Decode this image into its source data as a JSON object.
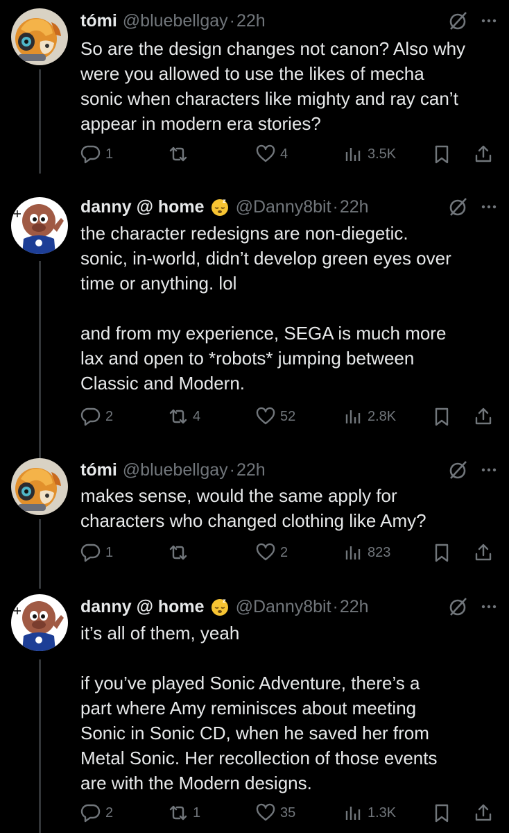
{
  "tweets": [
    {
      "name": "tómi",
      "handle": "@bluebellgay",
      "dot": "·",
      "time": "22h",
      "text": "So are the design changes not canon? Also why\nwere you allowed to use the likes of mecha\nsonic when characters like mighty and ray can’t\nappear in modern era stories?",
      "replies": "1",
      "reposts": "",
      "likes": "4",
      "views": "3.5K",
      "avatar": "tomi-avatar",
      "has_emoji": false
    },
    {
      "name": "danny @ home",
      "handle": "@Danny8bit",
      "dot": "·",
      "time": "22h",
      "text": "the character redesigns are non-diegetic.\nsonic, in-world, didn’t develop green eyes over\ntime or anything. lol\n\nand from my experience, SEGA is much more\nlax and open to *robots* jumping between\nClassic and Modern.",
      "replies": "2",
      "reposts": "4",
      "likes": "52",
      "views": "2.8K",
      "avatar": "danny-avatar",
      "has_emoji": true,
      "emoji": "sleeping-face-emoji"
    },
    {
      "name": "tómi",
      "handle": "@bluebellgay",
      "dot": "·",
      "time": "22h",
      "text": "makes sense, would the same apply for\ncharacters who changed clothing like Amy?",
      "replies": "1",
      "reposts": "",
      "likes": "2",
      "views": "823",
      "avatar": "tomi-avatar",
      "has_emoji": false
    },
    {
      "name": "danny @ home",
      "handle": "@Danny8bit",
      "dot": "·",
      "time": "22h",
      "text": "it’s all of them, yeah\n\nif you’ve played Sonic Adventure, there’s a\npart where Amy reminisces about meeting\nSonic in Sonic CD, when he saved her from\nMetal Sonic. Her recollection of those events\nare with the Modern designs.",
      "replies": "2",
      "reposts": "1",
      "likes": "35",
      "views": "1.3K",
      "avatar": "danny-avatar",
      "has_emoji": true,
      "emoji": "sleeping-face-emoji"
    }
  ],
  "colors": {
    "background": "#000000",
    "text": "#e7e9ea",
    "secondary": "#71767b",
    "thread_line": "#333639"
  },
  "icons": [
    "reply-icon",
    "repost-icon",
    "like-icon",
    "views-icon",
    "bookmark-icon",
    "share-icon",
    "grok-icon",
    "more-icon"
  ]
}
